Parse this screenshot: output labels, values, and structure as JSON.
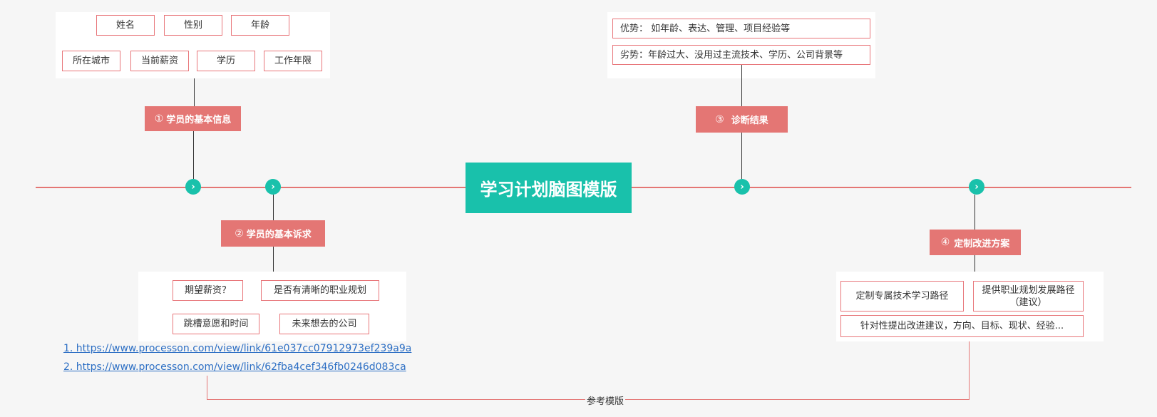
{
  "center_title": "学习计划脑图模版",
  "branches": {
    "b1": {
      "num": "①",
      "label": "学员的基本信息"
    },
    "b2": {
      "num": "②",
      "label": "学员的基本诉求"
    },
    "b3": {
      "num": "③",
      "label": "诊断结果"
    },
    "b4": {
      "num": "④",
      "label": "定制改进方案"
    }
  },
  "b1_items": [
    "姓名",
    "性别",
    "年龄",
    "所在城市",
    "当前薪资",
    "学历",
    "工作年限"
  ],
  "b2_items": [
    "期望薪资？",
    "是否有清晰的职业规划",
    "跳槽意愿和时间",
    "未来想去的公司"
  ],
  "b3_items": [
    "优势： 如年龄、表达、管理、项目经验等",
    "劣势：年龄过大、没用过主流技术、学历、公司背景等"
  ],
  "b4_items": [
    "定制专属技术学习路径",
    "提供职业规划发展路径（建议）",
    "针对性提出改进建议，方向、目标、现状、经验..."
  ],
  "links": [
    "1. https://www.processon.com/view/link/61e037cc07912973ef239a9a",
    "2. https://www.processon.com/view/link/62fba4cef346fb0246d083ca"
  ],
  "ref_label": "参考模版",
  "node_glyph": "›",
  "colors": {
    "teal": "#19c1ab",
    "coral": "#e47674",
    "link": "#2d6fc4"
  }
}
